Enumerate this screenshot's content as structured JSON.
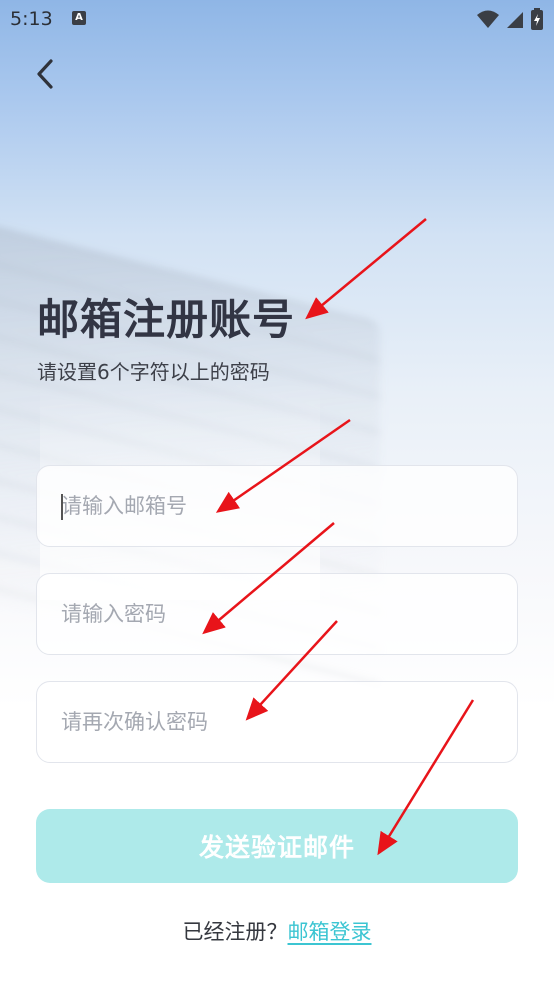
{
  "status_bar": {
    "time": "5:13",
    "notification_icon": "a-icon"
  },
  "header": {
    "back_icon": "chevron-left-icon"
  },
  "page": {
    "title": "邮箱注册账号",
    "subtitle": "请设置6个字符以上的密码"
  },
  "form": {
    "email_placeholder": "请输入邮箱号",
    "password_placeholder": "请输入密码",
    "confirm_placeholder": "请再次确认密码",
    "submit_label": "发送验证邮件"
  },
  "footer": {
    "prompt": "已经注册？",
    "link_label": "邮箱登录"
  },
  "colors": {
    "title": "#323544",
    "submit_button_bg": "#aeeaea",
    "link": "#3cc5d2",
    "annotation_arrow": "#e8141a"
  }
}
